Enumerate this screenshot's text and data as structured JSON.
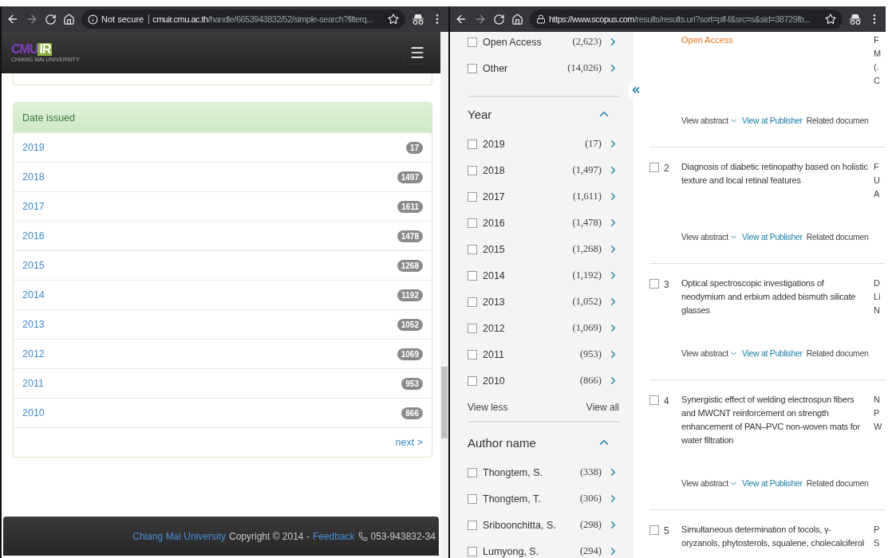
{
  "left_browser": {
    "address": {
      "security_label": "Not secure",
      "host": "cmuir.cmu.ac.th",
      "path": "/handle/6653943832/52/simple-search?filterq..."
    }
  },
  "cmuir_header": {
    "logo_part1": "CMU",
    "logo_part2": "IR",
    "logo_subtitle": "CHIANG MAI UNIVERSITY"
  },
  "date_issued": {
    "title": "Date issued",
    "rows": [
      {
        "year": "2019",
        "count": "17"
      },
      {
        "year": "2018",
        "count": "1497"
      },
      {
        "year": "2017",
        "count": "1611"
      },
      {
        "year": "2016",
        "count": "1478"
      },
      {
        "year": "2015",
        "count": "1268"
      },
      {
        "year": "2014",
        "count": "1192"
      },
      {
        "year": "2013",
        "count": "1052"
      },
      {
        "year": "2012",
        "count": "1069"
      },
      {
        "year": "2011",
        "count": "953"
      },
      {
        "year": "2010",
        "count": "866"
      }
    ],
    "next": "next >"
  },
  "footer": {
    "university": "Chiang Mai University",
    "copyright": "Copyright © 2014 -",
    "feedback": "Feedback",
    "phone": "053-943832-34"
  },
  "right_browser": {
    "address": {
      "scheme": "https://",
      "host": "www.scopus.com",
      "path": "/results/results.uri?sort=plf-f&src=s&sid=38729fb..."
    }
  },
  "access_filters": [
    {
      "label": "Open Access",
      "count": "(2,623)",
      "checked": false
    },
    {
      "label": "Other",
      "count": "(14,026)",
      "checked": false
    }
  ],
  "year_filter": {
    "title": "Year",
    "expanded": true,
    "items": [
      {
        "label": "2019",
        "count": "(17)",
        "checked": false
      },
      {
        "label": "2018",
        "count": "(1,497)",
        "checked": false
      },
      {
        "label": "2017",
        "count": "(1,611)",
        "checked": false
      },
      {
        "label": "2016",
        "count": "(1,478)",
        "checked": false
      },
      {
        "label": "2015",
        "count": "(1,268)",
        "checked": false
      },
      {
        "label": "2014",
        "count": "(1,192)",
        "checked": false
      },
      {
        "label": "2013",
        "count": "(1,052)",
        "checked": false
      },
      {
        "label": "2012",
        "count": "(1,069)",
        "checked": false
      },
      {
        "label": "2011",
        "count": "(953)",
        "checked": false
      },
      {
        "label": "2010",
        "count": "(866)",
        "checked": false
      }
    ],
    "view_less": "View less",
    "view_all": "View all"
  },
  "author_filter": {
    "title": "Author name",
    "expanded": true,
    "items": [
      {
        "label": "Thongtem, S.",
        "count": "(338)",
        "checked": false
      },
      {
        "label": "Thongtem, T.",
        "count": "(306)",
        "checked": false
      },
      {
        "label": "Sriboonchitta, S.",
        "count": "(298)",
        "checked": false
      },
      {
        "label": "Lumyong, S.",
        "count": "(294)",
        "checked": false
      }
    ]
  },
  "results": {
    "first_fragment": {
      "access_label": "Open Access",
      "right_column": [
        "F",
        "M",
        "(.",
        "C"
      ],
      "actions": {
        "view_abstract": "View abstract",
        "view_at_publisher": "View at Publisher",
        "related": "Related documen"
      }
    },
    "items": [
      {
        "number": "2",
        "checked": false,
        "title": "Diagnosis of diabetic retinopathy based on holistic texture and local retinal features",
        "right_column": [
          "F",
          "U",
          "A"
        ],
        "actions": {
          "view_abstract": "View abstract",
          "view_at_publisher": "View at Publisher",
          "related": "Related documen"
        }
      },
      {
        "number": "3",
        "checked": false,
        "title": "Optical spectroscopic investigations of neodymium and erbium added bismuth silicate glasses",
        "right_column": [
          "D",
          "Li",
          "N"
        ],
        "actions": {
          "view_abstract": "View abstract",
          "view_at_publisher": "View at Publisher",
          "related": "Related documen"
        }
      },
      {
        "number": "4",
        "checked": false,
        "title": "Synergistic effect of welding electrospun fibers and MWCNT reinforcement on strength enhancement of PAN–PVC non-woven mats for water filtration",
        "right_column": [
          "N",
          "P",
          "W"
        ],
        "actions": {
          "view_abstract": "View abstract",
          "view_at_publisher": "View at Publisher",
          "related": "Related documen"
        }
      },
      {
        "number": "5",
        "checked": false,
        "title": "Simultaneous determination of tocols, γ-oryzanols, phytosterols, squalene, cholecalciferol",
        "right_column": [
          "P",
          "S"
        ]
      }
    ]
  }
}
